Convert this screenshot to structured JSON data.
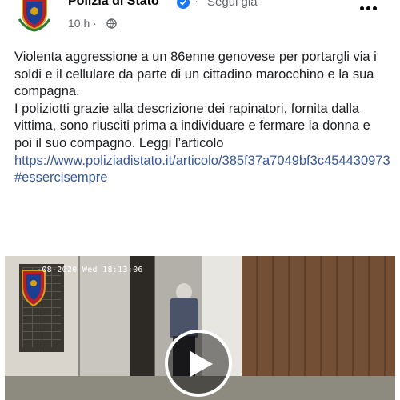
{
  "header": {
    "page_name": "Polizia di Stato",
    "separator": "·",
    "follow_label": "Segui già",
    "timestamp": "10 h ·"
  },
  "post": {
    "paragraph1": "Violenta aggressione a un 86enne genovese per portargli via i soldi e il cellulare da parte di un cittadino marocchino e la sua compagna.",
    "paragraph2": "I poliziotti grazie alla descrizione dei rapinatori, fornita dalla vittima, sono riusciti prima a individuare e fermare la donna e poi il suo compagno. Leggi l’articolo",
    "link": "https://www.poliziadistato.it/articolo/385f37a7049bf3c454430973",
    "hashtag": "#essercisempre"
  },
  "video": {
    "overlay_text": "-08-2020 Wed 18:13:06"
  },
  "icons": {
    "verified": "verified-badge-icon",
    "globe": "globe-icon",
    "more": "more-options-icon",
    "play": "play-icon"
  },
  "colors": {
    "link": "#385898",
    "verified": "#1877f2",
    "secondary_text": "#65676b"
  }
}
